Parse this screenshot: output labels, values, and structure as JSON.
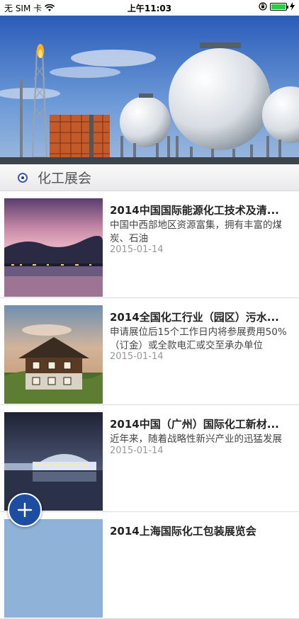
{
  "status_bar": {
    "carrier": "无 SIM 卡",
    "time": "上午11:03"
  },
  "section": {
    "title": "化工展会"
  },
  "items": [
    {
      "title": "2014中国国际能源化工技术及清...",
      "desc": "中国中西部地区资源富集，拥有丰富的煤炭、石油",
      "date": "2015-01-14"
    },
    {
      "title": "2014全国化工行业（园区）污水...",
      "desc": "申请展位后15个工作日内将参展费用50%（订金）或全款电汇或交至承办单位",
      "date": "2015-01-14"
    },
    {
      "title": "2014中国（广州）国际化工新材...",
      "desc": "近年来，随着战略性新兴产业的迅猛发展",
      "date": "2015-01-14"
    },
    {
      "title": "2014上海国际化工包装展览会"
    }
  ],
  "colors": {
    "accent": "#1c4da0",
    "battery": "#2ecc40"
  }
}
